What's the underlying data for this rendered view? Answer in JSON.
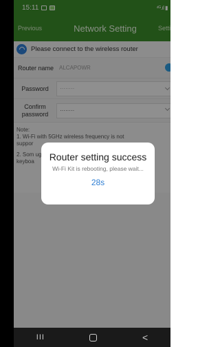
{
  "status_bar": {
    "time": "15:11",
    "right": "⁴ᴳ.ıl ▮"
  },
  "title_bar": {
    "left": "Previous",
    "title": "Network Setting",
    "right": "Setti"
  },
  "banner": {
    "text": "Please connect to the wireless router"
  },
  "form": {
    "router_label": "Router name",
    "router_value": "ALCAPOWR",
    "password_label": "Password",
    "password_value": "········",
    "confirm_label_1": "Confirm",
    "confirm_label_2": "password",
    "confirm_value": "········"
  },
  "notes": {
    "line0": "Note:",
    "line1": "1. Wi-Fi with 5GHz wireless frequency is not",
    "line2": "suppor",
    "line3": "2. Som                                          ugh th",
    "line4": "keyboa"
  },
  "dialog": {
    "title": "Router setting success",
    "message": "Wi-Fi Kit is rebooting, please wait...",
    "countdown": "28s"
  },
  "nav": {
    "recent": "III",
    "back": "<"
  }
}
